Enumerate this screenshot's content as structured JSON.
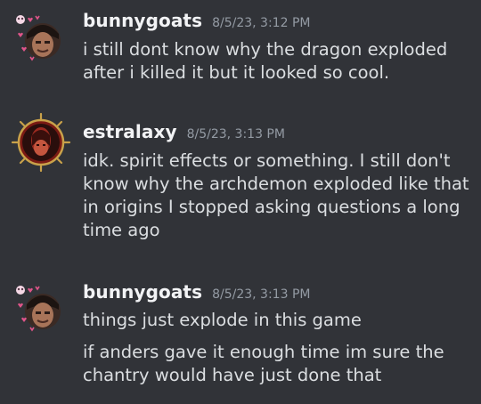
{
  "messages": [
    {
      "username": "bunnygoats",
      "timestamp": "8/5/23, 3:12 PM",
      "lines": [
        "i still dont know why the dragon exploded\nafter i killed it but it looked so cool."
      ],
      "avatar_icon": "bunnygoats-avatar-icon"
    },
    {
      "username": "estralaxy",
      "timestamp": "8/5/23, 3:13 PM",
      "lines": [
        "idk. spirit effects or something. I still don't\nknow why the archdemon exploded like that\nin origins I stopped asking questions a long\ntime ago"
      ],
      "avatar_icon": "estralaxy-avatar-icon"
    },
    {
      "username": "bunnygoats",
      "timestamp": "8/5/23, 3:13 PM",
      "lines": [
        "things just explode in this game",
        "if anders gave it enough time im sure the\nchantry would have just done that"
      ],
      "avatar_icon": "bunnygoats-avatar-icon"
    }
  ],
  "colors": {
    "background": "#313338",
    "username": "#f2f3f5",
    "timestamp": "#949ba4",
    "text": "#dbdee1",
    "heart_accent": "#e0558a"
  }
}
